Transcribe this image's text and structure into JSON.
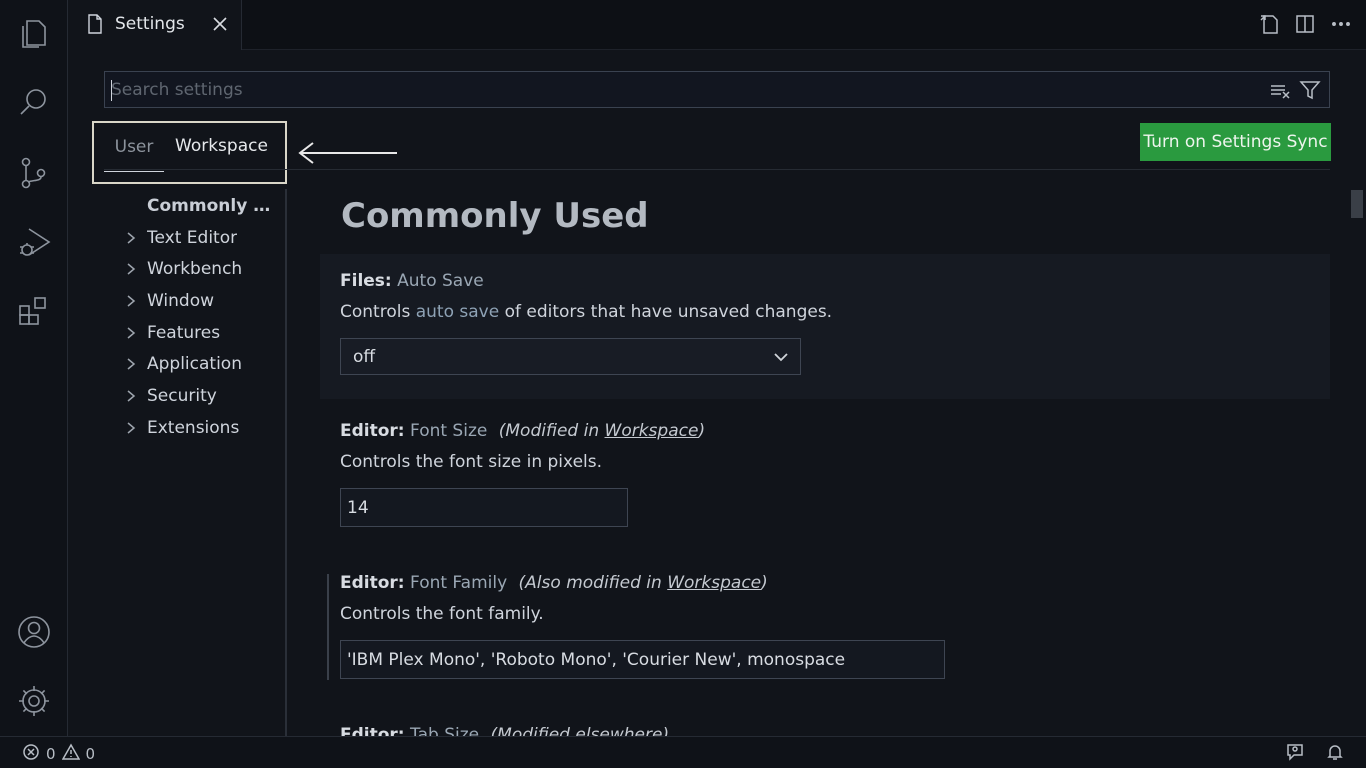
{
  "window": {
    "tab_label": "Settings",
    "tab_icon": "file-icon"
  },
  "activity_bar": {
    "items": [
      {
        "name": "explorer",
        "icon": "files-icon"
      },
      {
        "name": "search",
        "icon": "search-icon"
      },
      {
        "name": "source-control",
        "icon": "source-control-icon"
      },
      {
        "name": "run-debug",
        "icon": "run-debug-icon"
      },
      {
        "name": "extensions",
        "icon": "extensions-icon"
      },
      {
        "name": "accounts",
        "icon": "account-icon"
      },
      {
        "name": "manage",
        "icon": "gear-icon"
      }
    ]
  },
  "search": {
    "placeholder": "Search settings"
  },
  "scope_tabs": {
    "user": "User",
    "workspace": "Workspace"
  },
  "sync_button": "Turn on Settings Sync",
  "toc": [
    {
      "label": "Commonly U...",
      "active": true
    },
    {
      "label": "Text Editor"
    },
    {
      "label": "Workbench"
    },
    {
      "label": "Window"
    },
    {
      "label": "Features"
    },
    {
      "label": "Application"
    },
    {
      "label": "Security"
    },
    {
      "label": "Extensions"
    }
  ],
  "section_title": "Commonly Used",
  "settings": {
    "auto_save": {
      "category": "Files:",
      "name": "Auto Save",
      "desc_prefix": "Controls ",
      "desc_link": "auto save",
      "desc_suffix": " of editors that have unsaved changes.",
      "value": "off"
    },
    "font_size": {
      "category": "Editor:",
      "name": "Font Size",
      "mod_prefix": "(Modified in ",
      "mod_link": "Workspace",
      "mod_suffix": ")",
      "desc": "Controls the font size in pixels.",
      "value": "14"
    },
    "font_family": {
      "category": "Editor:",
      "name": "Font Family",
      "mod_prefix": "(Also modified in ",
      "mod_link": "Workspace",
      "mod_suffix": ")",
      "desc": "Controls the font family.",
      "value": "'IBM Plex Mono', 'Roboto Mono', 'Courier New', monospace"
    },
    "tab_size": {
      "category": "Editor:",
      "name": "Tab Size",
      "mod_text": "(Modified elsewhere)"
    }
  },
  "status_bar": {
    "errors": "0",
    "warnings": "0"
  },
  "colors": {
    "sync_button_bg": "#2a9a3f",
    "background": "#11141a"
  }
}
